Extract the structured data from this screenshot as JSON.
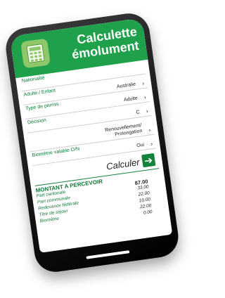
{
  "app": {
    "title_line1": "Calculette",
    "title_line2": "émolument"
  },
  "form": {
    "fields": [
      {
        "label": "Nationalité",
        "value": ""
      },
      {
        "label": "Adulte / Enfant",
        "value": "Australie"
      },
      {
        "label": "Type de permis",
        "value": "Adulte"
      },
      {
        "label": "Décision",
        "value": "C"
      },
      {
        "label": "",
        "value": "Renouvellement/ Prolongation"
      },
      {
        "label": "Biométrie valable O/N",
        "value": "Oui"
      }
    ]
  },
  "action": {
    "calculate_label": "Calculer"
  },
  "result": {
    "title": "MONTANT A PERCEVOIR",
    "items": [
      {
        "label": "Part cantonale",
        "value": "87.00"
      },
      {
        "label": "Part communale",
        "value": "33.00"
      },
      {
        "label": "Redevance fédérale",
        "value": "22.00"
      },
      {
        "label": "Titre de séjour",
        "value": "10.00"
      },
      {
        "label": "Biométrie",
        "value": "22.00"
      },
      {
        "label": "",
        "value": "0.00"
      }
    ]
  }
}
